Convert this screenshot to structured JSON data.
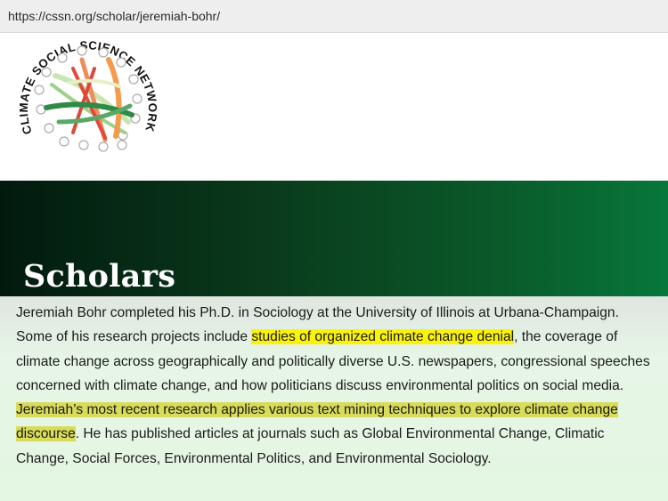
{
  "browser": {
    "url": "https://cssn.org/scholar/jeremiah-bohr/"
  },
  "logo": {
    "text": "CLIMATE SOCIAL SCIENCE NETWORK"
  },
  "hero": {
    "title": "Scholars"
  },
  "bio": {
    "part1": "Jeremiah Bohr completed his Ph.D. in Sociology at the University of Illinois at Urbana-Champaign. Some of his research projects include ",
    "highlight1": "studies of organized climate change denial",
    "part2": ", the coverage of climate change across geographically and politically diverse U.S. newspapers, congressional speeches concerned with climate change, and how politicians discuss environmental politics on social media. ",
    "highlight2": "Jeremiah’s most recent research applies various text mining techniques to explore climate change discourse",
    "part3": ". He has published articles at journals such as Global Environmental Change, Climatic Change, Social Forces, Environmental Politics, and Environmental Sociology."
  },
  "colors": {
    "highlight_primary": "#fbf20a",
    "highlight_secondary": "#d8dc5a",
    "hero_dark": "#021a0e",
    "hero_light": "#07773a"
  }
}
